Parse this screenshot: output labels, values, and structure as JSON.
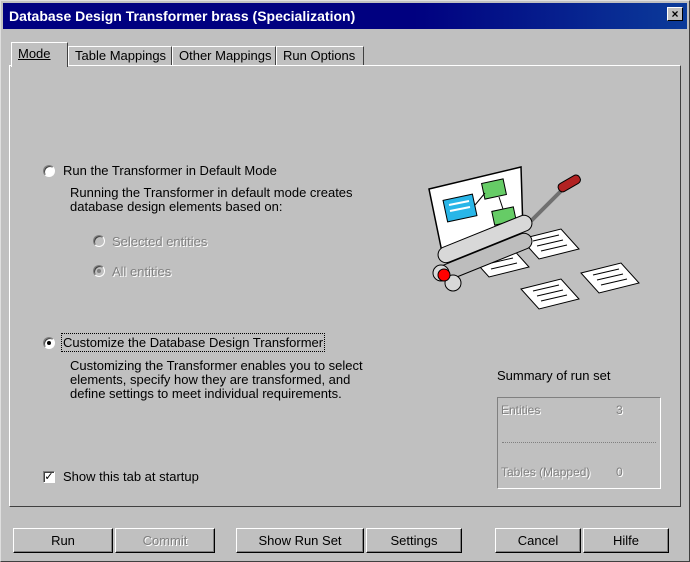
{
  "window": {
    "title": "Database Design Transformer brass (Specialization)",
    "close_label": "×"
  },
  "tabs": [
    {
      "label": "Mode",
      "active": true
    },
    {
      "label": "Table Mappings",
      "active": false
    },
    {
      "label": "Other Mappings",
      "active": false
    },
    {
      "label": "Run Options",
      "active": false
    }
  ],
  "mode": {
    "default_option": {
      "label": "Run the Transformer in Default Mode",
      "selected": false,
      "description_line1": "Running the Transformer in default mode creates",
      "description_line2": "database design elements based on:"
    },
    "sub_options": [
      {
        "label": "Selected entities",
        "selected": false,
        "enabled": false
      },
      {
        "label": "All entities",
        "selected": true,
        "enabled": false
      }
    ],
    "custom_option": {
      "label": "Customize the Database Design Transformer",
      "selected": true,
      "description_line1": "Customizing the Transformer enables you to select",
      "description_line2": "elements, specify how they are transformed, and",
      "description_line3": "define settings to meet individual requirements."
    },
    "show_tab_checkbox": {
      "label": "Show this tab at startup",
      "checked": true,
      "check_glyph": "✓"
    }
  },
  "summary": {
    "heading": "Summary of run set",
    "entities_label": "Entities",
    "entities_value": "3",
    "tables_label": "Tables (Mapped)",
    "tables_value": "0"
  },
  "illustration": {
    "icon": "transformer-machine-icon"
  },
  "buttons": {
    "run": "Run",
    "commit": "Commit",
    "show_run_set": "Show Run Set",
    "settings": "Settings",
    "cancel": "Cancel",
    "help": "Hilfe"
  },
  "colors": {
    "titlebar": "#000080",
    "face": "#c0c0c0",
    "disabled_text": "#808080"
  }
}
